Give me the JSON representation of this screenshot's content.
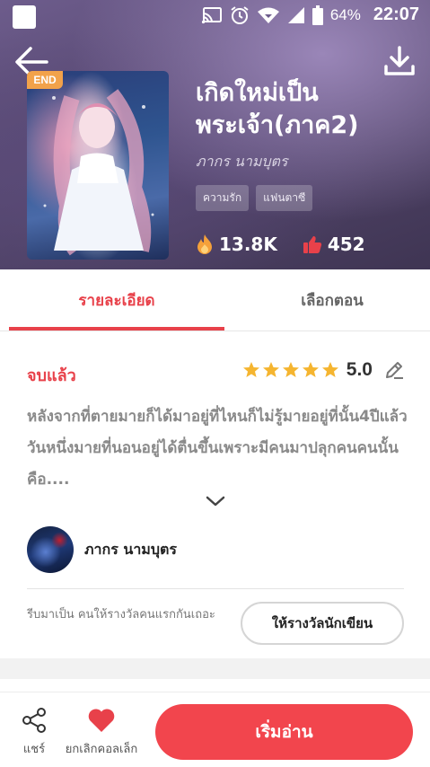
{
  "status_bar": {
    "battery": "64%",
    "time": "22:07"
  },
  "book": {
    "badge": "END",
    "title": "เกิดใหม่เป็นพระเจ้า(ภาค2)",
    "author": "ภากร นามบุตร",
    "tags": [
      "ความรัก",
      "แฟนตาซี"
    ],
    "views": "13.8K",
    "likes": "452"
  },
  "tabs": {
    "details": "รายละเอียด",
    "episodes": "เลือกตอน",
    "active": "details"
  },
  "details": {
    "status": "จบแล้ว",
    "rating_stars": 5,
    "rating_value": "5.0",
    "synopsis": "หลังจากที่ตายมายก็ได้มาอยู่ที่ไหนก็ไม่รู้มายอยู่ที่นั้น4ปีแล้ววันหนึ่งมายที่นอนอยู่ได้ตื่นขึ้นเพราะมีคนมาปลุกคนคนนั้นคือ...."
  },
  "writer": {
    "name": "ภากร นามบุตร"
  },
  "reward": {
    "note": "รีบมาเป็น คนให้รางวัลคนแรกกันเถอะ",
    "button": "ให้รางวัลนักเขียน"
  },
  "bottom_bar": {
    "share_label": "แชร์",
    "fav_label": "ยกเลิกคอลเล็ก",
    "read_label": "เริ่มอ่าน"
  },
  "colors": {
    "accent": "#e8414a",
    "read_button": "#f2454d",
    "star": "#f5b530",
    "end_badge": "#f2a24a"
  },
  "icons": [
    "back-arrow-icon",
    "download-icon",
    "fire-icon",
    "thumbs-up-icon",
    "star-icon",
    "edit-pencil-icon",
    "chevron-down-icon",
    "share-icon",
    "heart-icon",
    "cast-icon",
    "alarm-icon",
    "wifi-icon",
    "signal-icon",
    "battery-icon"
  ]
}
